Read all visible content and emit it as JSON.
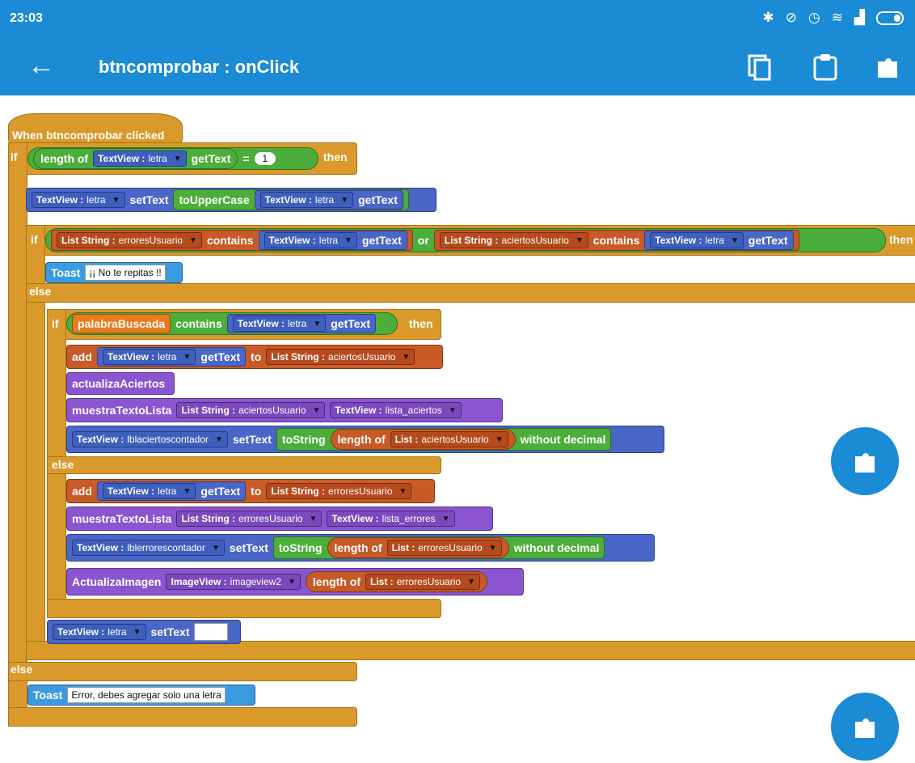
{
  "status": {
    "time": "23:03"
  },
  "appbar": {
    "title": "btncomprobar : onClick"
  },
  "icons": {
    "back": "arrow-left-icon",
    "copy": "copy-icon",
    "paste": "clipboard-icon",
    "puzzle": "puzzle-icon"
  },
  "blocks": {
    "hat": "When btncomprobar clicked",
    "kw_if": "if",
    "kw_else": "else",
    "kw_then": "then",
    "kw_then_cut": "then",
    "kw_or": "or",
    "kw_eq": "=",
    "kw_to": "to",
    "length_of": "length of",
    "get_text": "getText",
    "set_text": "setText",
    "to_upper": "toUpperCase",
    "to_string": "toString",
    "without_decimal": "without decimal",
    "contains": "contains",
    "add": "add",
    "toast": "Toast",
    "one": "1",
    "tv_letra_type": "TextView :",
    "tv_letra_name": "letra",
    "ls_errores": "erroresUsuario",
    "ls_aciertos": "aciertosUsuario",
    "ls_type": "List String :",
    "list_type": "List :",
    "toast_repeat": "¡¡ No te repitas !!",
    "palabra": "palabraBuscada",
    "actualiza": "actualizaAciertos",
    "muestra": "muestraTextoLista",
    "tv_lista_aciertos": "lista_aciertos",
    "tv_lista_errores": "lista_errores",
    "tv_lbl_aciertos": "lblaciertoscontador",
    "tv_lbl_errores": "lblerrorescontador",
    "actualiza_imagen": "ActualizaImagen",
    "iv_type": "ImageView :",
    "iv_name": "imageview2",
    "toast_error": "Error, debes agregar solo una letra"
  }
}
